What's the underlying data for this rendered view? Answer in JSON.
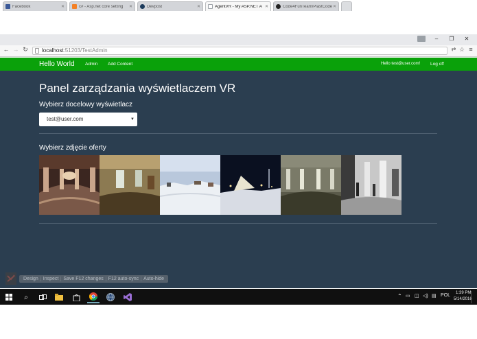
{
  "browser": {
    "tabs": [
      {
        "label": "Facebook",
        "icon": "facebook-icon",
        "color": "#3b5998"
      },
      {
        "label": "c# - Asp.net core setting",
        "icon": "stackoverflow-icon",
        "color": "#f48024"
      },
      {
        "label": "Devpost",
        "icon": "devpost-icon",
        "color": "#1d3b5c"
      },
      {
        "label": "AgentVR - My ASP.NET A",
        "icon": "page-icon",
        "color": "#9aa0a6"
      },
      {
        "label": "Code4FunTeam/PiastCode",
        "icon": "github-icon",
        "color": "#222222"
      }
    ],
    "url_host": "localhost",
    "url_path": ":51203/TestAdmin"
  },
  "site": {
    "brand": "Hello World",
    "nav": [
      "Admin",
      "Add Content"
    ],
    "greeting": "Hello test@user.com!",
    "logoff": "Log off",
    "nav_color": "#0aa10a",
    "bg_color": "#2b3e50"
  },
  "main": {
    "title": "Panel zarządzania wyświetlaczem VR",
    "display_heading": "Wybierz docelowy wyświetlacz",
    "display_selected": "test@user.com",
    "offer_heading": "Wybierz zdjęcie oferty",
    "photos": [
      {
        "name": "church-interior-panorama",
        "kind": "church"
      },
      {
        "name": "palace-room-panorama",
        "kind": "room"
      },
      {
        "name": "snowy-field-panorama",
        "kind": "snow"
      },
      {
        "name": "night-snow-panorama",
        "kind": "night"
      },
      {
        "name": "hall-interior-panorama",
        "kind": "hall"
      },
      {
        "name": "gallery-interior-panorama",
        "kind": "gallery"
      }
    ]
  },
  "browser_link": [
    "Design",
    "Inspect",
    "Save F12 changes",
    "F12 auto-sync",
    "Auto-hide"
  ],
  "taskbar": {
    "lang": "POL",
    "time": "1:39 PM",
    "date": "5/14/2016"
  }
}
